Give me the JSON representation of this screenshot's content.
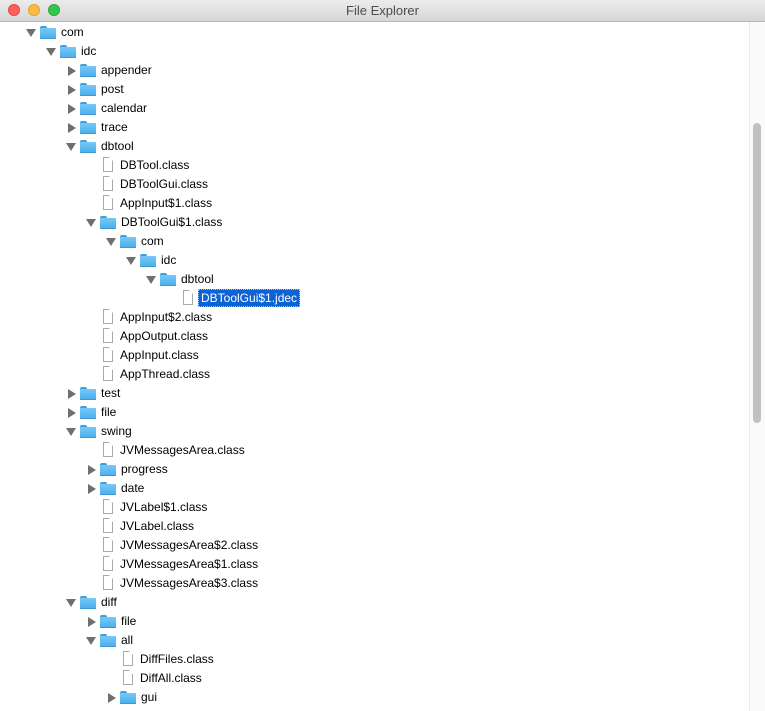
{
  "window": {
    "title": "File Explorer"
  },
  "tree": {
    "nodes": [
      {
        "label": "com",
        "depth": 0,
        "kind": "folder",
        "state": "expanded"
      },
      {
        "label": "idc",
        "depth": 1,
        "kind": "folder",
        "state": "expanded"
      },
      {
        "label": "appender",
        "depth": 2,
        "kind": "folder",
        "state": "collapsed"
      },
      {
        "label": "post",
        "depth": 2,
        "kind": "folder",
        "state": "collapsed"
      },
      {
        "label": "calendar",
        "depth": 2,
        "kind": "folder",
        "state": "collapsed"
      },
      {
        "label": "trace",
        "depth": 2,
        "kind": "folder",
        "state": "collapsed"
      },
      {
        "label": "dbtool",
        "depth": 2,
        "kind": "folder",
        "state": "expanded"
      },
      {
        "label": "DBTool.class",
        "depth": 3,
        "kind": "file"
      },
      {
        "label": "DBToolGui.class",
        "depth": 3,
        "kind": "file"
      },
      {
        "label": "AppInput$1.class",
        "depth": 3,
        "kind": "file"
      },
      {
        "label": "DBToolGui$1.class",
        "depth": 3,
        "kind": "folder",
        "state": "expanded"
      },
      {
        "label": "com",
        "depth": 4,
        "kind": "folder",
        "state": "expanded"
      },
      {
        "label": "idc",
        "depth": 5,
        "kind": "folder",
        "state": "expanded"
      },
      {
        "label": "dbtool",
        "depth": 6,
        "kind": "folder",
        "state": "expanded"
      },
      {
        "label": "DBToolGui$1.jdec",
        "depth": 7,
        "kind": "file",
        "selected": true
      },
      {
        "label": "AppInput$2.class",
        "depth": 3,
        "kind": "file"
      },
      {
        "label": "AppOutput.class",
        "depth": 3,
        "kind": "file"
      },
      {
        "label": "AppInput.class",
        "depth": 3,
        "kind": "file"
      },
      {
        "label": "AppThread.class",
        "depth": 3,
        "kind": "file"
      },
      {
        "label": "test",
        "depth": 2,
        "kind": "folder",
        "state": "collapsed"
      },
      {
        "label": "file",
        "depth": 2,
        "kind": "folder",
        "state": "collapsed"
      },
      {
        "label": "swing",
        "depth": 2,
        "kind": "folder",
        "state": "expanded"
      },
      {
        "label": "JVMessagesArea.class",
        "depth": 3,
        "kind": "file"
      },
      {
        "label": "progress",
        "depth": 3,
        "kind": "folder",
        "state": "collapsed"
      },
      {
        "label": "date",
        "depth": 3,
        "kind": "folder",
        "state": "collapsed"
      },
      {
        "label": "JVLabel$1.class",
        "depth": 3,
        "kind": "file"
      },
      {
        "label": "JVLabel.class",
        "depth": 3,
        "kind": "file"
      },
      {
        "label": "JVMessagesArea$2.class",
        "depth": 3,
        "kind": "file"
      },
      {
        "label": "JVMessagesArea$1.class",
        "depth": 3,
        "kind": "file"
      },
      {
        "label": "JVMessagesArea$3.class",
        "depth": 3,
        "kind": "file"
      },
      {
        "label": "diff",
        "depth": 2,
        "kind": "folder",
        "state": "expanded"
      },
      {
        "label": "file",
        "depth": 3,
        "kind": "folder",
        "state": "collapsed"
      },
      {
        "label": "all",
        "depth": 3,
        "kind": "folder",
        "state": "expanded"
      },
      {
        "label": "DiffFiles.class",
        "depth": 4,
        "kind": "file"
      },
      {
        "label": "DiffAll.class",
        "depth": 4,
        "kind": "file"
      },
      {
        "label": "gui",
        "depth": 4,
        "kind": "folder",
        "state": "collapsed"
      }
    ]
  },
  "icons": {
    "folder": "folder-icon",
    "file": "file-icon",
    "expanded": "triangle-down-icon",
    "collapsed": "triangle-right-icon"
  },
  "colors": {
    "selection": "#0d63d3",
    "folder": "#4aaeea",
    "toggle": "#6f6f6f"
  }
}
